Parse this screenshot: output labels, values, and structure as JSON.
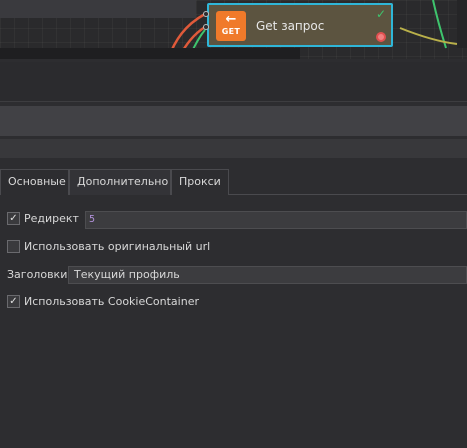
{
  "node": {
    "icon_verb": "GET",
    "icon_arrow": "←",
    "title": "Get запрос",
    "status_icon": "check-icon",
    "error_port_icon": "error-port-icon",
    "accent": "#2fb6d8",
    "icon_color": "#f07a2a",
    "body_color": "#5c5440"
  },
  "tabs": [
    {
      "label": "Основные",
      "active": false
    },
    {
      "label": "Дополнительно",
      "active": true
    },
    {
      "label": "Прокси",
      "active": false
    }
  ],
  "settings": {
    "redirect": {
      "label": "Редирект",
      "checked": true,
      "value": "5"
    },
    "original_url": {
      "label": "Использовать оригинальный url",
      "checked": false
    },
    "headers": {
      "label": "Заголовки:",
      "value": "Текущий профиль"
    },
    "cookie_container": {
      "label": "Использовать CookieContainer",
      "checked": true
    }
  },
  "check_glyph": "✓"
}
